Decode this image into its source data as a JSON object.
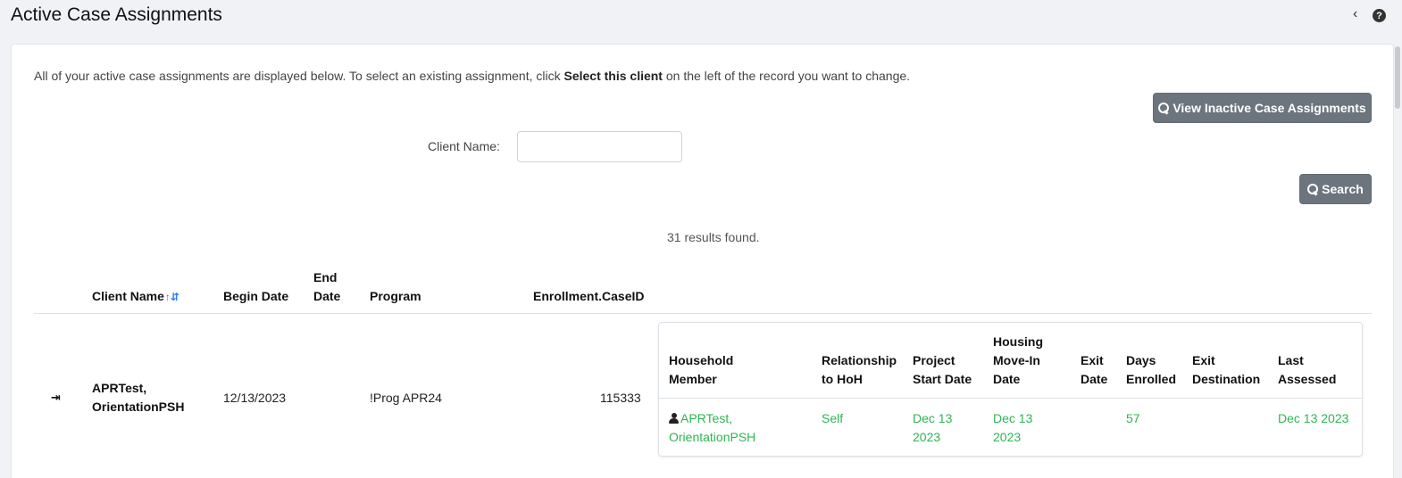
{
  "header": {
    "title": "Active Case Assignments",
    "collapse_glyph": "‹",
    "help_glyph": "?"
  },
  "intro": {
    "prefix": "All of your active case assignments are displayed below. To select an existing assignment, click ",
    "emphasis": "Select this client",
    "suffix": " on the left of the record you want to change."
  },
  "buttons": {
    "inactive_label": "View Inactive Case Assignments",
    "search_label": "Search"
  },
  "search": {
    "label": "Client Name:",
    "value": "",
    "placeholder": ""
  },
  "results_text": "31 results found.",
  "table": {
    "columns": {
      "client_name": "Client Name",
      "begin_date": "Begin Date",
      "end_date_1": "End",
      "end_date_2": "Date",
      "program": "Program",
      "case_id": "Enrollment.CaseID"
    },
    "sort_glyph": "↑⇵",
    "rows": [
      {
        "client_1": "APRTest,",
        "client_2": "OrientationPSH",
        "begin_date": "12/13/2023",
        "end_date": "",
        "program": "!Prog APR24",
        "case_id": "115333"
      }
    ]
  },
  "household": {
    "columns": {
      "member_1": "Household",
      "member_2": "Member",
      "rel_1": "Relationship",
      "rel_2": "to HoH",
      "start_1": "Project",
      "start_2": "Start Date",
      "movein_1": "Housing",
      "movein_2": "Move-In",
      "movein_3": "Date",
      "exit_1": "Exit",
      "exit_2": "Date",
      "days_1": "Days",
      "days_2": "Enrolled",
      "dest_1": "Exit",
      "dest_2": "Destination",
      "assessed_1": "Last",
      "assessed_2": "Assessed"
    },
    "rows": [
      {
        "member_1": "APRTest,",
        "member_2": "OrientationPSH",
        "relationship": "Self",
        "start_1": "Dec 13",
        "start_2": "2023",
        "movein_1": "Dec 13",
        "movein_2": "2023",
        "exit_date": "",
        "days_enrolled": "57",
        "exit_destination": "",
        "last_assessed": "Dec 13 2023"
      }
    ]
  },
  "colors": {
    "accent_green": "#2fb552",
    "button_gray": "#6c757d",
    "sort_blue": "#2979ff"
  }
}
